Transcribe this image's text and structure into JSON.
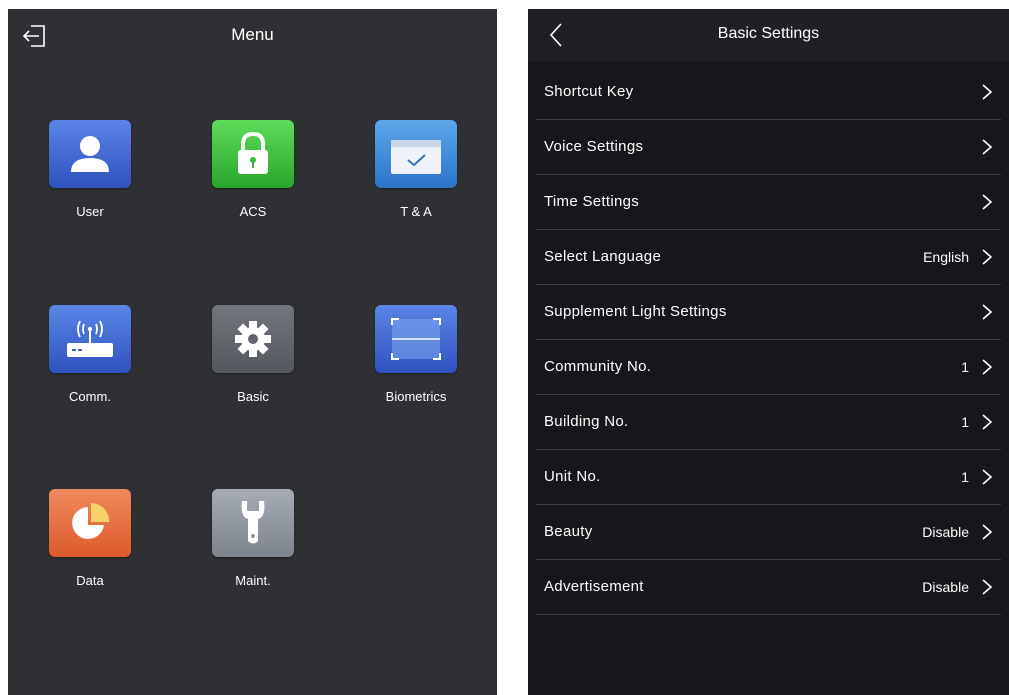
{
  "menu_panel": {
    "title": "Menu",
    "exit_icon": "exit-icon",
    "tiles": [
      {
        "label": "User",
        "icon": "user-icon",
        "color": "#3f66d6"
      },
      {
        "label": "ACS",
        "icon": "lock-icon",
        "color": "#36b935"
      },
      {
        "label": "T & A",
        "icon": "calendar-check-icon",
        "color": "#3d8bd9"
      },
      {
        "label": "Comm.",
        "icon": "router-icon",
        "color": "#3f66d6"
      },
      {
        "label": "Basic",
        "icon": "gear-icon",
        "color": "#61646b"
      },
      {
        "label": "Biometrics",
        "icon": "scan-frame-icon",
        "color": "#3f66d6"
      },
      {
        "label": "Data",
        "icon": "pie-chart-icon",
        "color": "#e56d3b"
      },
      {
        "label": "Maint.",
        "icon": "wrench-icon",
        "color": "#8e949c"
      }
    ]
  },
  "settings_panel": {
    "title": "Basic Settings",
    "back_icon": "back-chevron-icon",
    "rows": [
      {
        "label": "Shortcut Key",
        "value": ""
      },
      {
        "label": "Voice Settings",
        "value": ""
      },
      {
        "label": "Time Settings",
        "value": ""
      },
      {
        "label": "Select Language",
        "value": "English"
      },
      {
        "label": "Supplement Light Settings",
        "value": ""
      },
      {
        "label": "Community No.",
        "value": "1"
      },
      {
        "label": "Building No.",
        "value": "1"
      },
      {
        "label": "Unit No.",
        "value": "1"
      },
      {
        "label": "Beauty",
        "value": "Disable"
      },
      {
        "label": "Advertisement",
        "value": "Disable"
      }
    ]
  },
  "colors": {
    "menu_bg": "#2f3034",
    "settings_bg": "#16171b",
    "header_bg": "#1e2025",
    "divider": "#3a3b40"
  }
}
